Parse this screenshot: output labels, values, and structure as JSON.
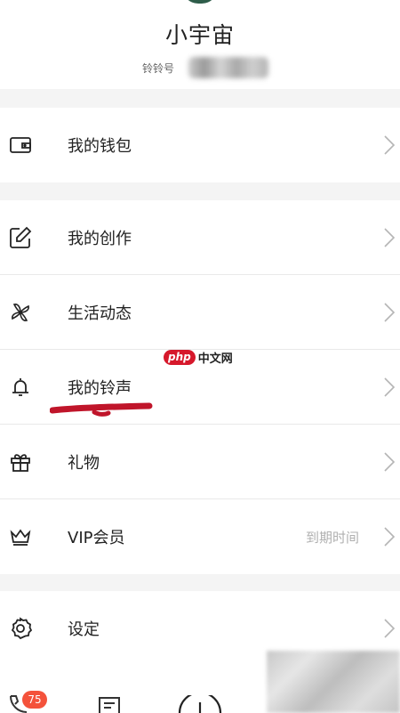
{
  "profile": {
    "username": "小宇宙",
    "id_label": "铃铃号"
  },
  "menu": {
    "wallet": {
      "label": "我的钱包",
      "icon": "wallet-icon"
    },
    "creation": {
      "label": "我的创作",
      "icon": "edit-icon"
    },
    "moments": {
      "label": "生活动态",
      "icon": "pinwheel-icon"
    },
    "ringtone": {
      "label": "我的铃声",
      "icon": "bell-icon"
    },
    "gift": {
      "label": "礼物",
      "icon": "gift-icon"
    },
    "vip": {
      "label": "VIP会员",
      "icon": "crown-icon",
      "right_text": "到期时间"
    },
    "settings": {
      "label": "设定",
      "icon": "gear-icon"
    }
  },
  "watermark": {
    "brand": "php",
    "text": "中文网"
  },
  "tabbar": {
    "badge": "75"
  },
  "colors": {
    "background": "#f4f4f4",
    "annotation": "#c0152a",
    "badge": "#f4523b"
  }
}
